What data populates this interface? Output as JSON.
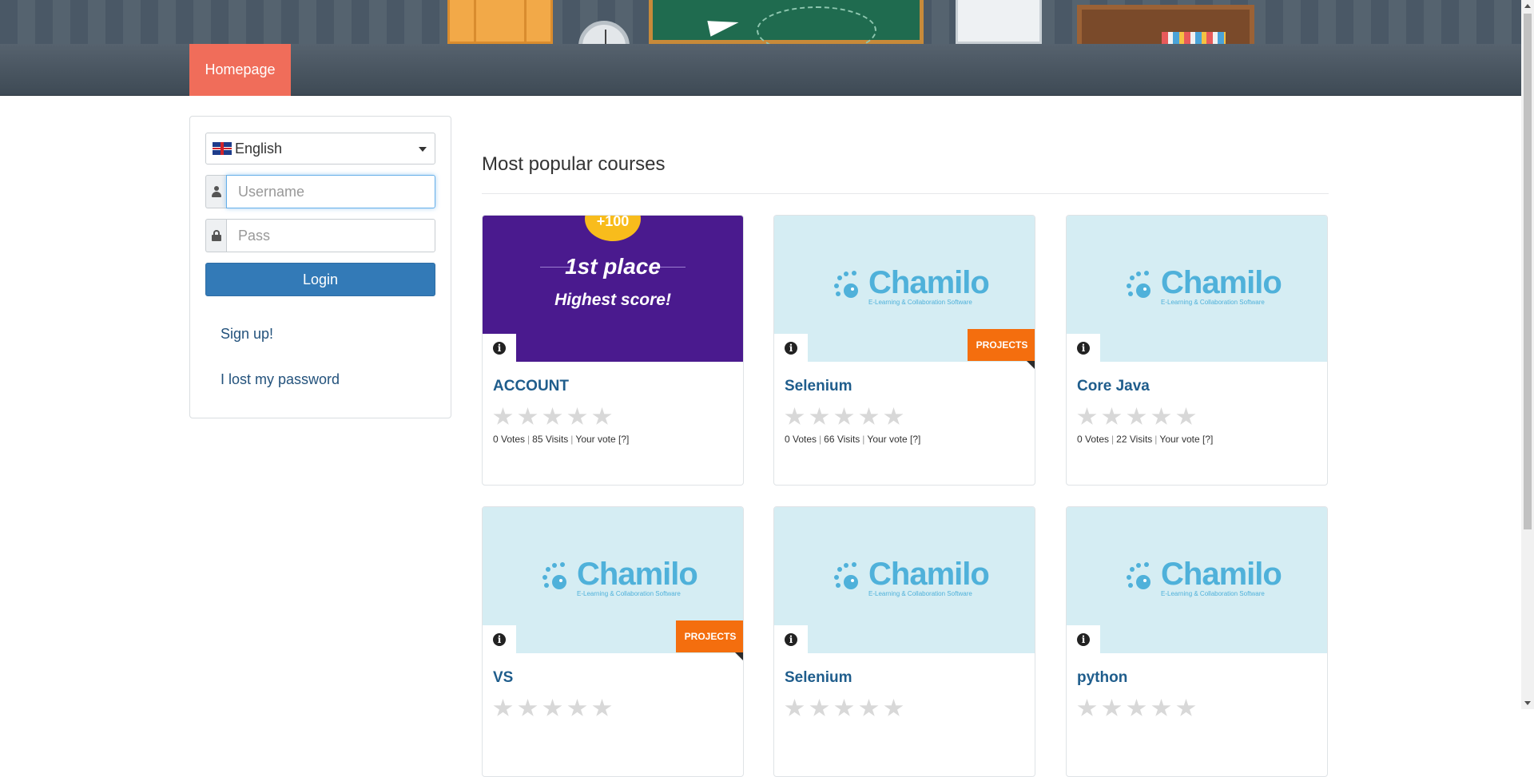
{
  "nav": {
    "home_label": "Homepage"
  },
  "login": {
    "language": "English",
    "username_placeholder": "Username",
    "password_placeholder": "Pass",
    "login_label": "Login",
    "signup_label": "Sign up!",
    "lost_password_label": "I lost my password"
  },
  "main": {
    "section_title": "Most popular courses",
    "courses": [
      {
        "title": "ACCOUNT",
        "votes": "0 Votes",
        "visits": "85 Visits",
        "your_vote": "Your vote [?]",
        "rating_stars": 0,
        "image": "promo",
        "promo_coin": "+100",
        "promo_place": "1st place",
        "promo_score": "Highest score!"
      },
      {
        "title": "Selenium",
        "votes": "0 Votes",
        "visits": "66 Visits",
        "your_vote": "Your vote [?]",
        "rating_stars": 0,
        "image": "chamilo",
        "ribbon": "PROJECTS"
      },
      {
        "title": "Core Java",
        "votes": "0 Votes",
        "visits": "22 Visits",
        "your_vote": "Your vote [?]",
        "rating_stars": 0,
        "image": "chamilo"
      },
      {
        "title": "VS",
        "image": "chamilo",
        "ribbon": "PROJECTS"
      },
      {
        "title": "Selenium",
        "image": "chamilo"
      },
      {
        "title": "python",
        "image": "chamilo"
      }
    ],
    "logo_text": "Chamilo",
    "logo_tagline": "E-Learning & Collaboration Software"
  },
  "colors": {
    "nav_active": "#f06d5a",
    "primary_button": "#337ab7",
    "ribbon": "#f46e0e",
    "link": "#1f5d8c",
    "card_image_bg": "#d5edf3",
    "promo_bg": "#4a1a8e"
  },
  "icons": [
    "user-icon",
    "lock-icon",
    "info-icon",
    "star-icon",
    "chevron-down-icon",
    "uk-flag-icon"
  ]
}
